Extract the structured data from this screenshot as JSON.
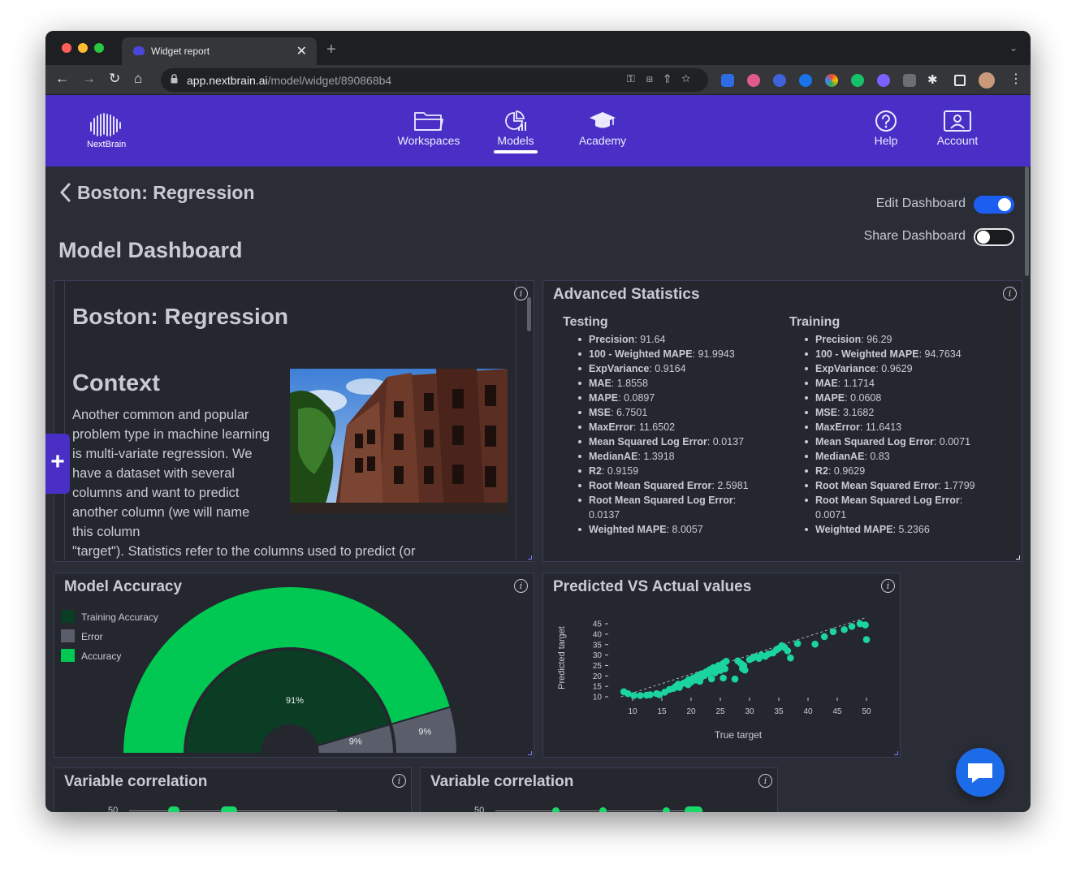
{
  "browser": {
    "tab_title": "Widget report",
    "url_host": "app.nextbrain.ai",
    "url_path": "/model/widget/890868b4"
  },
  "app": {
    "logo_text": "NextBrain",
    "nav": {
      "workspaces": "Workspaces",
      "models": "Models",
      "academy": "Academy",
      "help": "Help",
      "account": "Account"
    },
    "active_nav": "models",
    "brand_color": "#4a2fc6"
  },
  "page": {
    "back_title": "Boston: Regression",
    "title": "Model Dashboard",
    "edit_dashboard_label": "Edit Dashboard",
    "edit_dashboard_on": true,
    "share_dashboard_label": "Share Dashboard",
    "share_dashboard_on": false
  },
  "text_widget": {
    "heading": "Boston: Regression",
    "subheading": "Context",
    "body": "Another common and popular problem type in machine learning is multi-variate regression. We have a dataset with several columns and want to predict another column (we will name this column",
    "body_tail": "\"target\"). Statistics refer to the columns used to predict (or"
  },
  "advanced_stats": {
    "title": "Advanced Statistics",
    "testing": {
      "heading": "Testing",
      "items": [
        {
          "name": "Precision",
          "value": "91.64"
        },
        {
          "name": "100 - Weighted MAPE",
          "value": "91.9943"
        },
        {
          "name": "ExpVariance",
          "value": "0.9164"
        },
        {
          "name": "MAE",
          "value": "1.8558"
        },
        {
          "name": "MAPE",
          "value": "0.0897"
        },
        {
          "name": "MSE",
          "value": "6.7501"
        },
        {
          "name": "MaxError",
          "value": "11.6502"
        },
        {
          "name": "Mean Squared Log Error",
          "value": "0.0137"
        },
        {
          "name": "MedianAE",
          "value": "1.3918"
        },
        {
          "name": "R2",
          "value": "0.9159"
        },
        {
          "name": "Root Mean Squared Error",
          "value": "2.5981"
        },
        {
          "name": "Root Mean Squared Log Error",
          "value": "0.0137"
        },
        {
          "name": "Weighted MAPE",
          "value": "8.0057"
        }
      ]
    },
    "training": {
      "heading": "Training",
      "items": [
        {
          "name": "Precision",
          "value": "96.29"
        },
        {
          "name": "100 - Weighted MAPE",
          "value": "94.7634"
        },
        {
          "name": "ExpVariance",
          "value": "0.9629"
        },
        {
          "name": "MAE",
          "value": "1.1714"
        },
        {
          "name": "MAPE",
          "value": "0.0608"
        },
        {
          "name": "MSE",
          "value": "3.1682"
        },
        {
          "name": "MaxError",
          "value": "11.6413"
        },
        {
          "name": "Mean Squared Log Error",
          "value": "0.0071"
        },
        {
          "name": "MedianAE",
          "value": "0.83"
        },
        {
          "name": "R2",
          "value": "0.9629"
        },
        {
          "name": "Root Mean Squared Error",
          "value": "1.7799"
        },
        {
          "name": "Root Mean Squared Log Error",
          "value": "0.0071"
        },
        {
          "name": "Weighted MAPE",
          "value": "5.2366"
        }
      ]
    }
  },
  "model_accuracy": {
    "title": "Model Accuracy",
    "legend": [
      {
        "label": "Training Accuracy",
        "color": "#0b3d24"
      },
      {
        "label": "Error",
        "color": "#5a5e6b"
      },
      {
        "label": "Accuracy",
        "color": "#00c853"
      }
    ]
  },
  "predicted_vs_actual": {
    "title": "Predicted VS Actual values"
  },
  "variable_correlation": {
    "title_1": "Variable correlation",
    "title_2": "Variable correlation",
    "partial_tick": "50"
  },
  "chart_data": [
    {
      "type": "pie",
      "title": "Model Accuracy",
      "style": "semi-donut",
      "rings": [
        {
          "name": "Accuracy",
          "slices": [
            {
              "label": "Accuracy",
              "value": 91,
              "display": "91%",
              "color": "#00c853"
            },
            {
              "label": "Error",
              "value": 9,
              "display": "9%",
              "color": "#5a5e6b"
            }
          ]
        },
        {
          "name": "Training Accuracy",
          "slices": [
            {
              "label": "Training Accuracy",
              "value": 91,
              "display": "91%",
              "color": "#0b3d24"
            },
            {
              "label": "Error",
              "value": 9,
              "display": "9%",
              "color": "#5a5e6b"
            }
          ]
        }
      ]
    },
    {
      "type": "scatter",
      "title": "Predicted VS Actual values",
      "xlabel": "True target",
      "ylabel": "Predicted target",
      "x_ticks": [
        10,
        15,
        20,
        25,
        30,
        35,
        40,
        45,
        50
      ],
      "y_ticks": [
        10,
        15,
        20,
        25,
        30,
        35,
        40,
        45
      ],
      "xlim": [
        8,
        50
      ],
      "ylim": [
        10,
        46
      ],
      "point_color": "#1bd4a0",
      "reference_line": "dashed diagonal",
      "points": [
        [
          8.5,
          12.4
        ],
        [
          9.2,
          11.5
        ],
        [
          10.2,
          10.6
        ],
        [
          11.3,
          10.6
        ],
        [
          12.4,
          10.8
        ],
        [
          13.0,
          11.0
        ],
        [
          14.1,
          11.5
        ],
        [
          14.6,
          11.0
        ],
        [
          15.5,
          12.2
        ],
        [
          16.3,
          13.5
        ],
        [
          17.0,
          14.0
        ],
        [
          17.4,
          15.0
        ],
        [
          17.8,
          16.0
        ],
        [
          18.0,
          14.5
        ],
        [
          18.7,
          16.5
        ],
        [
          19.2,
          17.2
        ],
        [
          19.6,
          18.2
        ],
        [
          20.0,
          17.0
        ],
        [
          20.4,
          19.0
        ],
        [
          20.8,
          18.0
        ],
        [
          21.0,
          19.8
        ],
        [
          21.4,
          20.5
        ],
        [
          21.7,
          19.2
        ],
        [
          22.0,
          21.0
        ],
        [
          22.3,
          20.2
        ],
        [
          22.6,
          22.0
        ],
        [
          23.0,
          21.2
        ],
        [
          23.2,
          23.0
        ],
        [
          23.5,
          22.1
        ],
        [
          23.8,
          24.0
        ],
        [
          24.1,
          21.5
        ],
        [
          24.4,
          23.5
        ],
        [
          24.7,
          25.0
        ],
        [
          25.0,
          22.6
        ],
        [
          25.2,
          24.2
        ],
        [
          25.5,
          26.0
        ],
        [
          25.8,
          23.4
        ],
        [
          26.0,
          27.0
        ],
        [
          19.5,
          15.8
        ],
        [
          21.5,
          17.4
        ],
        [
          23.5,
          18.6
        ],
        [
          25.5,
          19.0
        ],
        [
          27.5,
          18.5
        ],
        [
          28.0,
          27.2
        ],
        [
          28.5,
          26.0
        ],
        [
          29.0,
          25.0
        ],
        [
          28.8,
          23.5
        ],
        [
          29.2,
          22.8
        ],
        [
          30.0,
          27.8
        ],
        [
          30.5,
          28.5
        ],
        [
          31.0,
          29.2
        ],
        [
          31.6,
          28.4
        ],
        [
          32.0,
          30.0
        ],
        [
          32.7,
          29.4
        ],
        [
          33.2,
          30.5
        ],
        [
          34.0,
          31.0
        ],
        [
          34.6,
          32.5
        ],
        [
          35.0,
          33.2
        ],
        [
          35.5,
          34.5
        ],
        [
          36.0,
          33.6
        ],
        [
          36.5,
          32.0
        ],
        [
          37.0,
          28.6
        ],
        [
          38.2,
          35.5
        ],
        [
          41.2,
          35.2
        ],
        [
          42.8,
          38.8
        ],
        [
          44.3,
          41.2
        ],
        [
          46.2,
          42.2
        ],
        [
          47.5,
          43.7
        ],
        [
          48.9,
          45.0
        ],
        [
          49.8,
          44.4
        ],
        [
          50.0,
          37.4
        ]
      ]
    }
  ]
}
